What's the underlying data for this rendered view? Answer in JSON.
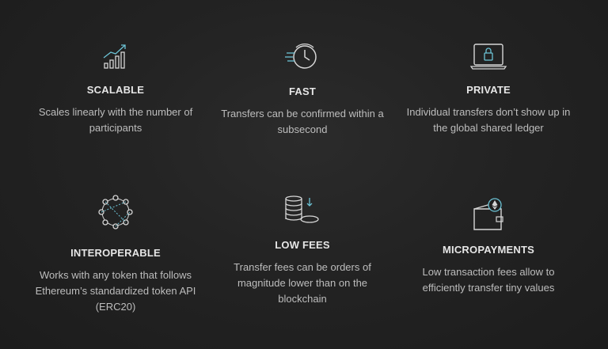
{
  "accent_color": "#6cc3d5",
  "features": [
    {
      "icon": "bar-chart-growth-icon",
      "title": "SCALABLE",
      "description_lines": [
        "Scales linearly with the number of",
        "participants"
      ]
    },
    {
      "icon": "fast-clock-icon",
      "title": "FAST",
      "description_lines": [
        "Transfers can be confirmed within a",
        "subsecond"
      ]
    },
    {
      "icon": "private-laptop-lock-icon",
      "title": "PRIVATE",
      "description_lines": [
        "Individual transfers don’t show up in",
        "the global shared ledger"
      ]
    },
    {
      "icon": "network-nodes-icon",
      "title": "INTEROPERABLE",
      "description_lines": [
        "Works with any token that follows",
        "Ethereum’s standardized token API",
        "(ERC20)"
      ]
    },
    {
      "icon": "coin-stack-icon",
      "title": "LOW FEES",
      "description_lines": [
        "Transfer fees can be orders of",
        "magnitude lower than on the",
        "blockchain"
      ]
    },
    {
      "icon": "wallet-ether-icon",
      "title": "MICROPAYMENTS",
      "description_lines": [
        "Low transaction fees allow to",
        "efficiently transfer tiny values"
      ]
    }
  ]
}
